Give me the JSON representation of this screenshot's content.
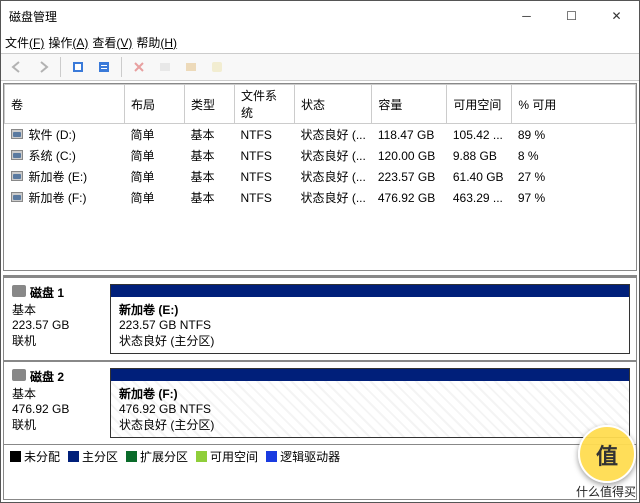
{
  "app": {
    "title": "磁盘管理"
  },
  "menu": {
    "file": {
      "label": "文件",
      "hotkey": "(F)"
    },
    "action": {
      "label": "操作",
      "hotkey": "(A)"
    },
    "view": {
      "label": "查看",
      "hotkey": "(V)"
    },
    "help": {
      "label": "帮助",
      "hotkey": "(H)"
    }
  },
  "columns": {
    "volume": "卷",
    "layout": "布局",
    "type": "类型",
    "fs": "文件系统",
    "status": "状态",
    "capacity": "容量",
    "free": "可用空间",
    "pct": "% 可用"
  },
  "volumes": [
    {
      "name": "软件 (D:)",
      "layout": "简单",
      "type": "基本",
      "fs": "NTFS",
      "status": "状态良好 (...",
      "capacity": "118.47 GB",
      "free": "105.42 ...",
      "pct": "89 %"
    },
    {
      "name": "系统 (C:)",
      "layout": "简单",
      "type": "基本",
      "fs": "NTFS",
      "status": "状态良好 (...",
      "capacity": "120.00 GB",
      "free": "9.88 GB",
      "pct": "8 %"
    },
    {
      "name": "新加卷 (E:)",
      "layout": "简单",
      "type": "基本",
      "fs": "NTFS",
      "status": "状态良好 (...",
      "capacity": "223.57 GB",
      "free": "61.40 GB",
      "pct": "27 %"
    },
    {
      "name": "新加卷 (F:)",
      "layout": "简单",
      "type": "基本",
      "fs": "NTFS",
      "status": "状态良好 (...",
      "capacity": "476.92 GB",
      "free": "463.29 ...",
      "pct": "97 %"
    }
  ],
  "disks": [
    {
      "name": "磁盘 1",
      "type": "基本",
      "size": "223.57 GB",
      "status": "联机",
      "part": {
        "name": "新加卷 (E:)",
        "desc": "223.57 GB NTFS",
        "status": "状态良好 (主分区)",
        "striped": false
      }
    },
    {
      "name": "磁盘 2",
      "type": "基本",
      "size": "476.92 GB",
      "status": "联机",
      "part": {
        "name": "新加卷 (F:)",
        "desc": "476.92 GB NTFS",
        "status": "状态良好 (主分区)",
        "striped": true
      }
    }
  ],
  "legend": {
    "unalloc": {
      "label": "未分配",
      "color": "#000000"
    },
    "primary": {
      "label": "主分区",
      "color": "#001f7a"
    },
    "extended": {
      "label": "扩展分区",
      "color": "#0a6b2a"
    },
    "free": {
      "label": "可用空间",
      "color": "#8fce3a"
    },
    "logical": {
      "label": "逻辑驱动器",
      "color": "#1a3be0"
    }
  },
  "watermark": {
    "char": "值",
    "tag": "什么值得买"
  }
}
